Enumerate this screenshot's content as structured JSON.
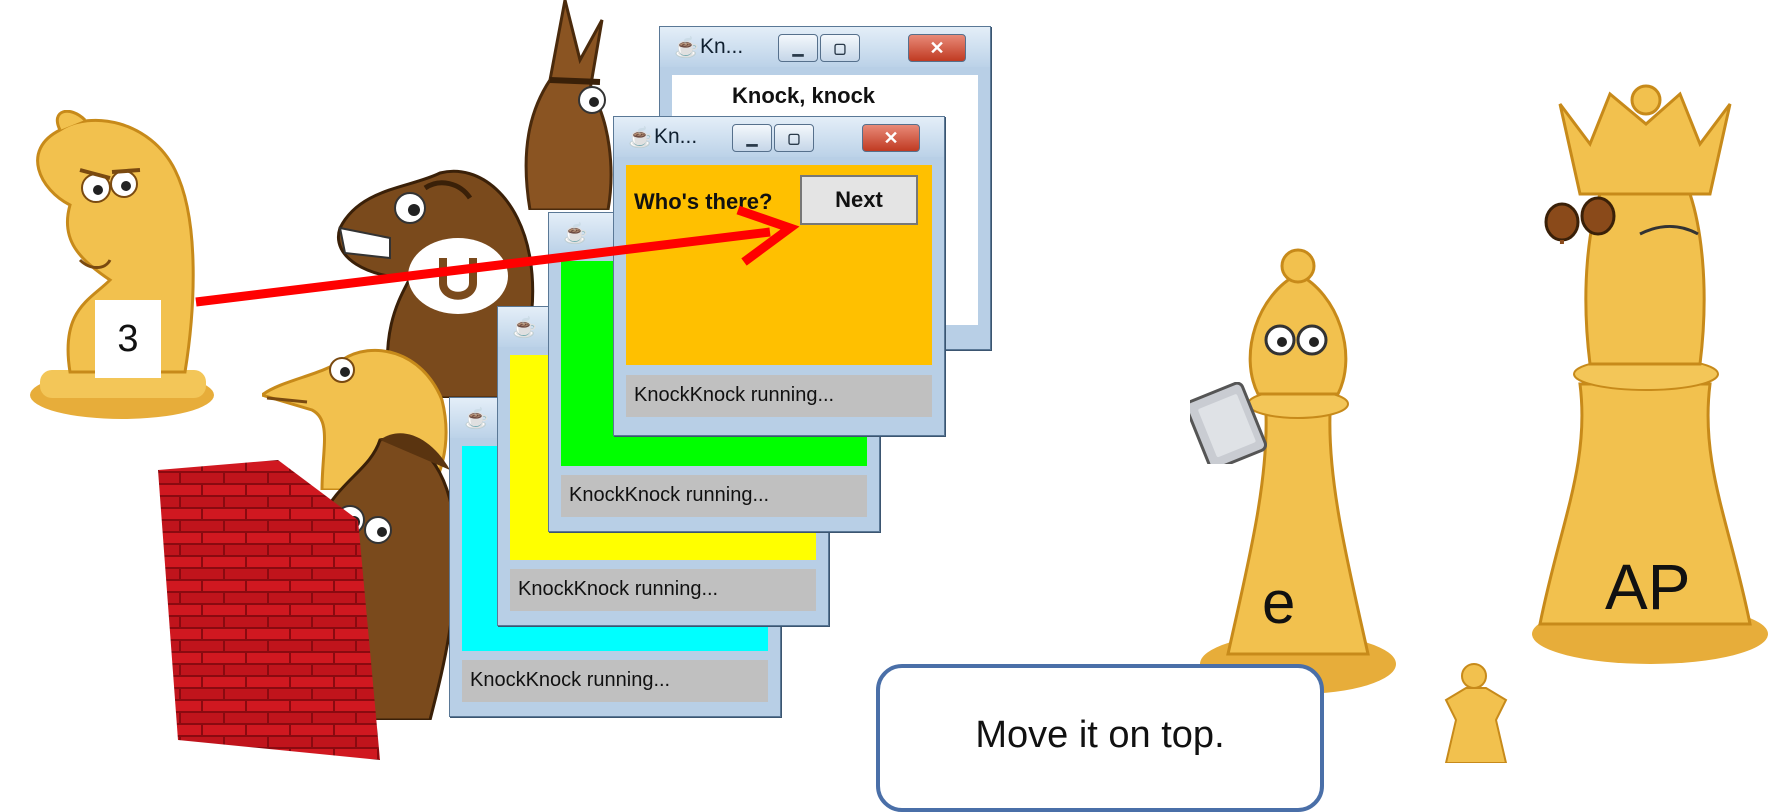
{
  "piece_labels": {
    "knight_label": "3",
    "bishop_label": "e",
    "queen_label": "AP"
  },
  "windows": [
    {
      "title": "Kn...",
      "header": "Knock, knock",
      "status": "",
      "content_color": "#ffffff"
    },
    {
      "title": "Kn...",
      "header": "Who's there?",
      "button": "Next",
      "status": "KnockKnock running...",
      "content_color": "#ffc000"
    },
    {
      "title": "",
      "status": "KnockKnock running...",
      "content_color": "#00ff00"
    },
    {
      "title": "",
      "status": "KnockKnock running...",
      "content_color": "#ffff00"
    },
    {
      "title": "",
      "status": "KnockKnock running...",
      "content_color": "#00ffff"
    }
  ],
  "callout": {
    "text": "Move it on top."
  },
  "colors": {
    "arrow": "#ff0000",
    "gold": "#f2c14e",
    "brown": "#7a4a1c",
    "brick": "#c0141c"
  },
  "icons": [
    "java-coffee-icon",
    "minimize-icon",
    "maximize-icon",
    "close-icon",
    "horseshoe-icon",
    "tablet-icon",
    "binoculars-icon"
  ]
}
